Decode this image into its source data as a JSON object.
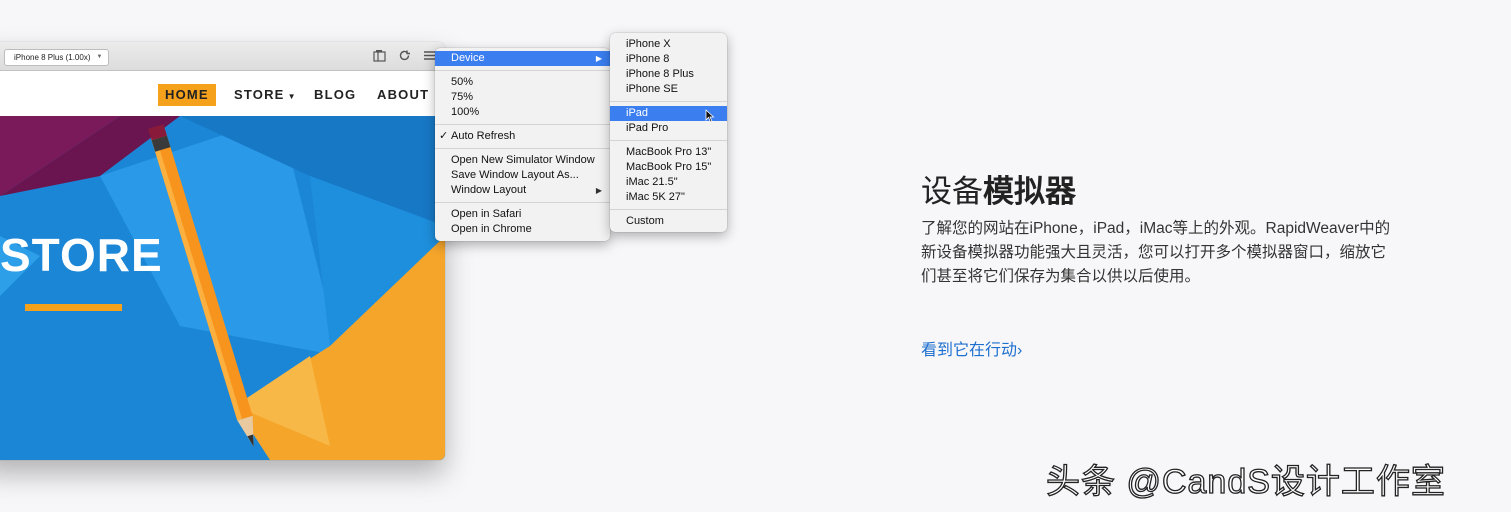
{
  "simulator": {
    "device_select": "iPhone 8 Plus (1.00x)",
    "nav": [
      "HOME",
      "STORE",
      "BLOG",
      "ABOUT"
    ],
    "hero_title": "STORE"
  },
  "menu_main": {
    "device": "Device",
    "zoom": [
      "50%",
      "75%",
      "100%"
    ],
    "auto_refresh": "Auto Refresh",
    "window_items": [
      "Open New Simulator Window",
      "Save Window Layout As...",
      "Window Layout"
    ],
    "open_items": [
      "Open in Safari",
      "Open in Chrome"
    ]
  },
  "menu_devices": {
    "group1": [
      "iPhone X",
      "iPhone 8",
      "iPhone 8 Plus",
      "iPhone SE"
    ],
    "group2": [
      "iPad",
      "iPad Pro"
    ],
    "group3": [
      "MacBook Pro 13\"",
      "MacBook Pro 15\"",
      "iMac 21.5\"",
      "iMac 5K 27\""
    ],
    "custom": "Custom",
    "selected": "iPad"
  },
  "feature": {
    "title_plain": "设备",
    "title_bold": "模拟器",
    "description": "了解您的网站在iPhone，iPad，iMac等上的外观。RapidWeaver中的新设备模拟器功能强大且灵活，您可以打开多个模拟器窗口，缩放它们甚至将它们保存为集合以供以后使用。",
    "link": "看到它在行动›"
  },
  "watermark": "头条 @CandS设计工作室",
  "colors": {
    "accent": "#f5a11c",
    "hero_blue": "#1b86d6",
    "highlight": "#3a7ef0",
    "link": "#1d6fd0"
  }
}
